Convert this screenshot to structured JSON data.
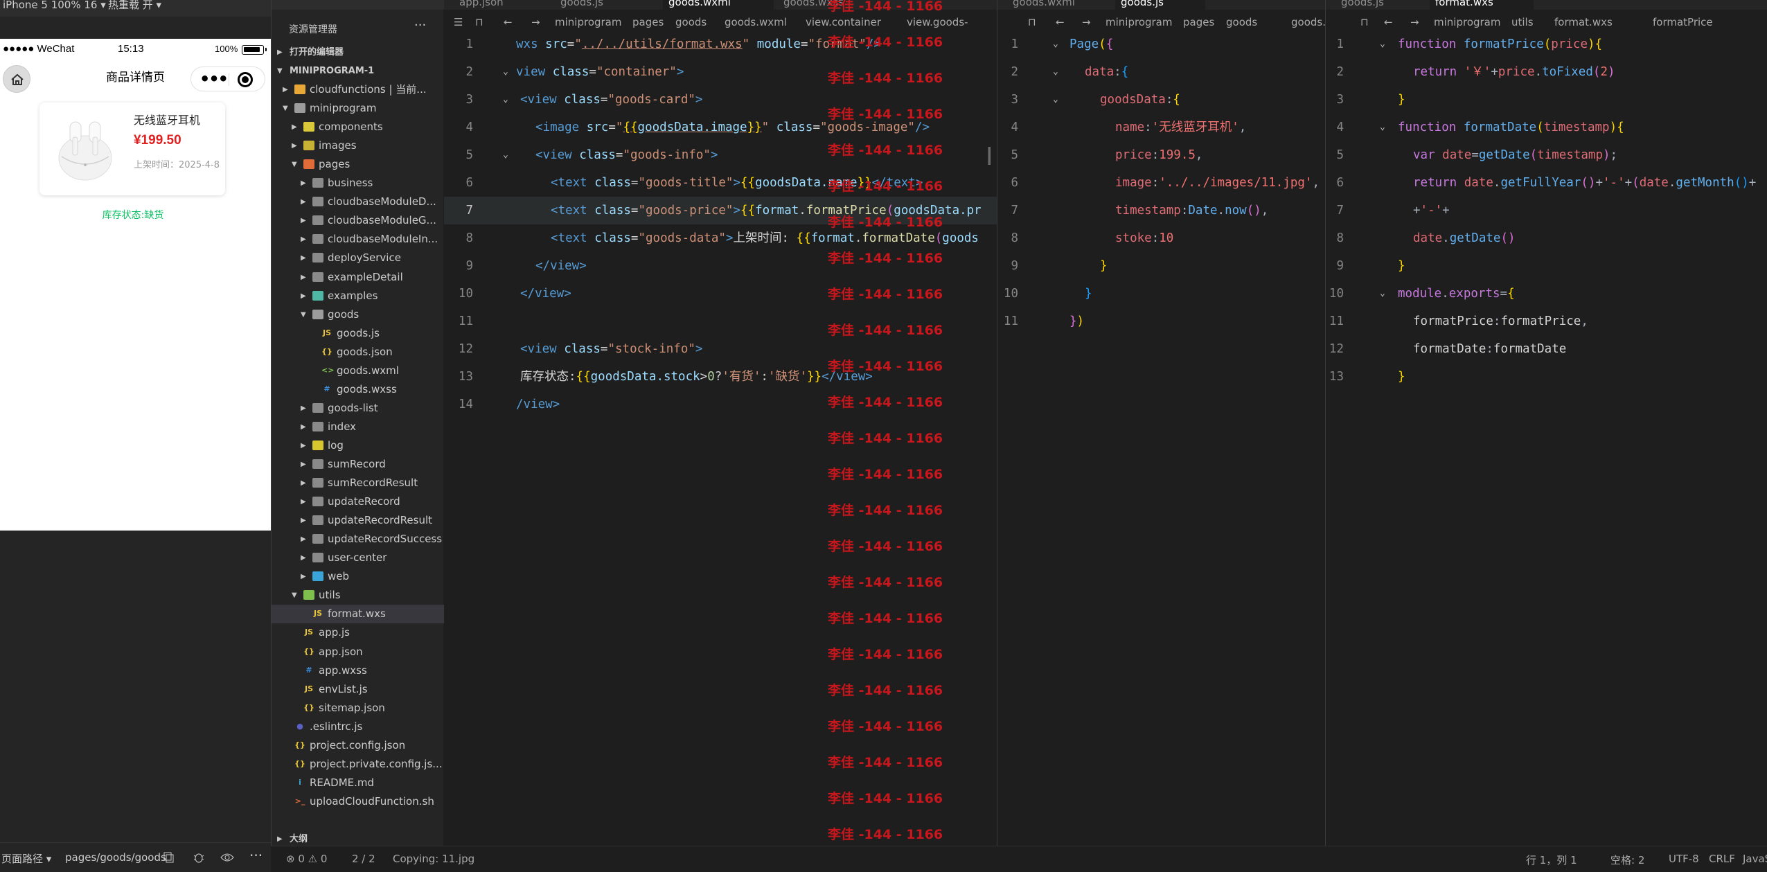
{
  "simulator": {
    "device_label": "iPhone 5 100% 16 ▾",
    "mode_label": "热重载 开 ▾",
    "status": {
      "carrier": "●●●●● WeChat",
      "time": "15:13",
      "battery_pct": "100%"
    },
    "nav_title": "商品详情页",
    "goods": {
      "title": "无线蓝牙耳机",
      "price": "¥199.50",
      "date": "上架时间：2025-4-8"
    },
    "stock_info": "库存状态:缺货",
    "bottom": {
      "path_label": "页面路径 ▾",
      "path": "pages/goods/goods"
    }
  },
  "explorer": {
    "title": "资源管理器",
    "more": "···",
    "open_editors": "打开的编辑器",
    "project": "MINIPROGRAM-1",
    "outline": "大纲",
    "rows": [
      {
        "label": "cloudfunctions | 当前...",
        "depth": 1,
        "kind": "folder",
        "icon": "cloud",
        "expanded": false
      },
      {
        "label": "miniprogram",
        "depth": 1,
        "kind": "folder",
        "icon": "open",
        "expanded": true
      },
      {
        "label": "components",
        "depth": 2,
        "kind": "folder",
        "icon": "comp",
        "expanded": false
      },
      {
        "label": "images",
        "depth": 2,
        "kind": "folder",
        "icon": "img",
        "expanded": false
      },
      {
        "label": "pages",
        "depth": 2,
        "kind": "folder",
        "icon": "pages",
        "expanded": true
      },
      {
        "label": "business",
        "depth": 3,
        "kind": "folder",
        "icon": "plain",
        "expanded": false
      },
      {
        "label": "cloudbaseModuleD...",
        "depth": 3,
        "kind": "folder",
        "icon": "plain",
        "expanded": false
      },
      {
        "label": "cloudbaseModuleG...",
        "depth": 3,
        "kind": "folder",
        "icon": "plain",
        "expanded": false
      },
      {
        "label": "cloudbaseModuleIn...",
        "depth": 3,
        "kind": "folder",
        "icon": "plain",
        "expanded": false
      },
      {
        "label": "deployService",
        "depth": 3,
        "kind": "folder",
        "icon": "plain",
        "expanded": false
      },
      {
        "label": "exampleDetail",
        "depth": 3,
        "kind": "folder",
        "icon": "plain",
        "expanded": false
      },
      {
        "label": "examples",
        "depth": 3,
        "kind": "folder",
        "icon": "ex",
        "expanded": false
      },
      {
        "label": "goods",
        "depth": 3,
        "kind": "folder",
        "icon": "open",
        "expanded": true
      },
      {
        "label": "goods.js",
        "depth": 4,
        "kind": "file",
        "icon": "js"
      },
      {
        "label": "goods.json",
        "depth": 4,
        "kind": "file",
        "icon": "json"
      },
      {
        "label": "goods.wxml",
        "depth": 4,
        "kind": "file",
        "icon": "wxml"
      },
      {
        "label": "goods.wxss",
        "depth": 4,
        "kind": "file",
        "icon": "wxss"
      },
      {
        "label": "goods-list",
        "depth": 3,
        "kind": "folder",
        "icon": "plain",
        "expanded": false
      },
      {
        "label": "index",
        "depth": 3,
        "kind": "folder",
        "icon": "plain",
        "expanded": false
      },
      {
        "label": "log",
        "depth": 3,
        "kind": "folder",
        "icon": "log",
        "expanded": false
      },
      {
        "label": "sumRecord",
        "depth": 3,
        "kind": "folder",
        "icon": "plain",
        "expanded": false
      },
      {
        "label": "sumRecordResult",
        "depth": 3,
        "kind": "folder",
        "icon": "plain",
        "expanded": false
      },
      {
        "label": "updateRecord",
        "depth": 3,
        "kind": "folder",
        "icon": "plain",
        "expanded": false
      },
      {
        "label": "updateRecordResult",
        "depth": 3,
        "kind": "folder",
        "icon": "plain",
        "expanded": false
      },
      {
        "label": "updateRecordSuccess",
        "depth": 3,
        "kind": "folder",
        "icon": "plain",
        "expanded": false
      },
      {
        "label": "user-center",
        "depth": 3,
        "kind": "folder",
        "icon": "plain",
        "expanded": false
      },
      {
        "label": "web",
        "depth": 3,
        "kind": "folder",
        "icon": "web",
        "expanded": false
      },
      {
        "label": "utils",
        "depth": 2,
        "kind": "folder",
        "icon": "utils",
        "expanded": true
      },
      {
        "label": "format.wxs",
        "depth": 3,
        "kind": "file",
        "icon": "js",
        "selected": true
      },
      {
        "label": "app.js",
        "depth": 2,
        "kind": "file",
        "icon": "js"
      },
      {
        "label": "app.json",
        "depth": 2,
        "kind": "file",
        "icon": "json"
      },
      {
        "label": "app.wxss",
        "depth": 2,
        "kind": "file",
        "icon": "wxss"
      },
      {
        "label": "envList.js",
        "depth": 2,
        "kind": "file",
        "icon": "js"
      },
      {
        "label": "sitemap.json",
        "depth": 2,
        "kind": "file",
        "icon": "json"
      },
      {
        "label": ".eslintrc.js",
        "depth": 1,
        "kind": "file",
        "icon": "eslint"
      },
      {
        "label": "project.config.json",
        "depth": 1,
        "kind": "file",
        "icon": "json"
      },
      {
        "label": "project.private.config.js...",
        "depth": 1,
        "kind": "file",
        "icon": "json"
      },
      {
        "label": "README.md",
        "depth": 1,
        "kind": "file",
        "icon": "info"
      },
      {
        "label": "uploadCloudFunction.sh",
        "depth": 1,
        "kind": "file",
        "icon": "sh"
      }
    ]
  },
  "pane1": {
    "tabs": [
      "app.json",
      "goods.js",
      "goods.wxml",
      "goods.wxss"
    ],
    "breadcrumb": [
      "miniprogram",
      "pages",
      "goods",
      "goods.wxml",
      "view.container",
      "view.goods-"
    ],
    "current_line": 7
  },
  "pane2": {
    "tabs": [
      "goods.wxml",
      "goods.js"
    ],
    "breadcrumb": [
      "miniprogram",
      "pages",
      "goods",
      "goods."
    ]
  },
  "pane3": {
    "tabs": [
      "goods.js",
      "format.wxs"
    ],
    "breadcrumb": [
      "miniprogram",
      "utils",
      "format.wxs",
      "formatPrice"
    ]
  },
  "watermark": "李佳 -144 - 1166",
  "statusbar": {
    "problems": "⊗ 0  ⚠ 0",
    "pages": "2 / 2",
    "copying": "Copying: 11.jpg",
    "position": "行 1，列 1",
    "spaces": "空格: 2",
    "encoding": "UTF-8",
    "eol": "CRLF",
    "language": "JavaScript"
  }
}
